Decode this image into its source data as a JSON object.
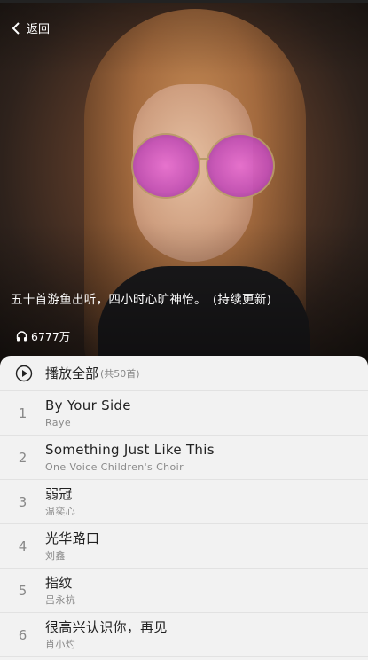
{
  "header": {
    "back_label": "返回",
    "title": "五十首游鱼出听，四小时心旷神怡。　(持续更新)",
    "play_count": "6777万"
  },
  "list": {
    "play_all_label": "播放全部",
    "play_all_count": "(共50首)",
    "songs": [
      {
        "index": "1",
        "title": "By Your Side",
        "artist": "Raye"
      },
      {
        "index": "2",
        "title": "Something Just Like This",
        "artist": "One Voice Children's Choir"
      },
      {
        "index": "3",
        "title": "弱冠",
        "artist": "温奕心"
      },
      {
        "index": "4",
        "title": "光华路口",
        "artist": "刘鑫"
      },
      {
        "index": "5",
        "title": "指纹",
        "artist": "吕永杭"
      },
      {
        "index": "6",
        "title": "很高兴认识你，再见",
        "artist": "肖小灼"
      }
    ]
  }
}
